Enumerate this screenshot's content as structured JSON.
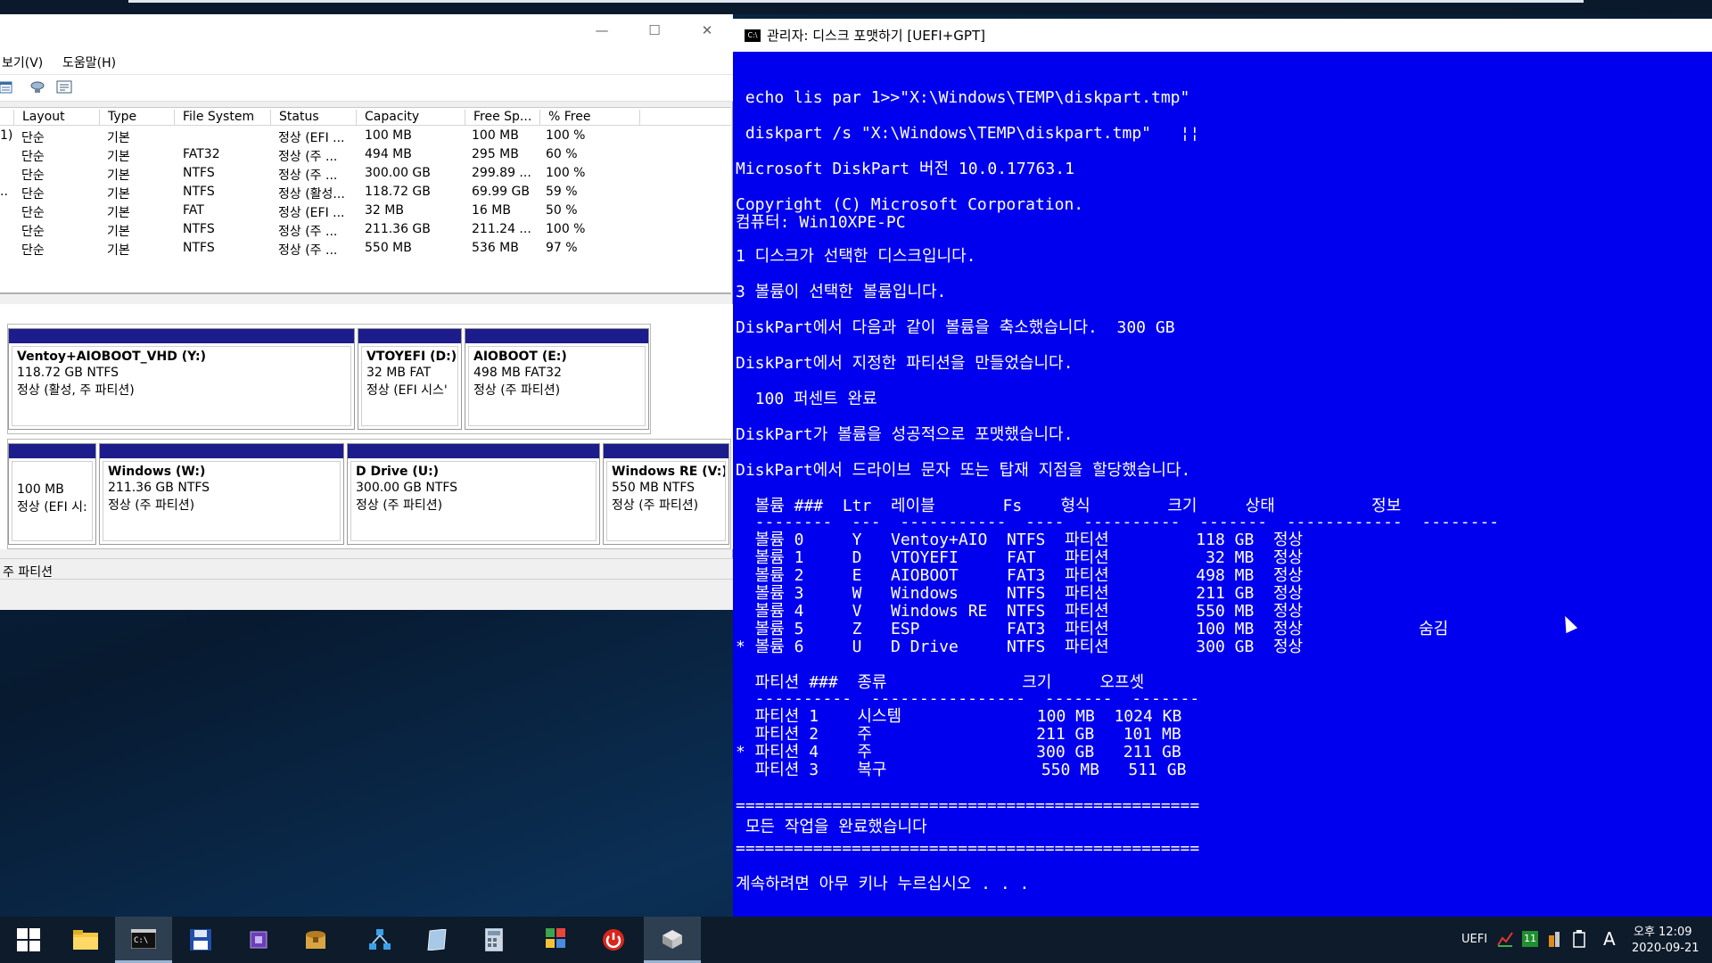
{
  "disk_management": {
    "menu": [
      "보기(V)",
      "도움말(H)"
    ],
    "columns": [
      "Layout",
      "Type",
      "File System",
      "Status",
      "Capacity",
      "Free Sp...",
      "% Free"
    ],
    "rows": [
      {
        "mark": "1)",
        "layout": "단순",
        "type": "기본",
        "fs": "",
        "status": "정상 (EFI ...",
        "capacity": "100 MB",
        "free": "100 MB",
        "pct": "100 %"
      },
      {
        "mark": "",
        "layout": "단순",
        "type": "기본",
        "fs": "FAT32",
        "status": "정상 (주 ...",
        "capacity": "494 MB",
        "free": "295 MB",
        "pct": "60 %"
      },
      {
        "mark": "",
        "layout": "단순",
        "type": "기본",
        "fs": "NTFS",
        "status": "정상 (주 ...",
        "capacity": "300.00 GB",
        "free": "299.89 ...",
        "pct": "100 %"
      },
      {
        "mark": "..",
        "layout": "단순",
        "type": "기본",
        "fs": "NTFS",
        "status": "정상 (활성...",
        "capacity": "118.72 GB",
        "free": "69.99 GB",
        "pct": "59 %"
      },
      {
        "mark": "",
        "layout": "단순",
        "type": "기본",
        "fs": "FAT",
        "status": "정상 (EFI ...",
        "capacity": "32 MB",
        "free": "16 MB",
        "pct": "50 %"
      },
      {
        "mark": "",
        "layout": "단순",
        "type": "기본",
        "fs": "NTFS",
        "status": "정상 (주 ...",
        "capacity": "211.36 GB",
        "free": "211.24 ...",
        "pct": "100 %"
      },
      {
        "mark": "",
        "layout": "단순",
        "type": "기본",
        "fs": "NTFS",
        "status": "정상 (주 ...",
        "capacity": "550 MB",
        "free": "536 MB",
        "pct": "97 %"
      }
    ],
    "disk1_parts": [
      {
        "name": "Ventoy+AIOBOOT_VHD  (Y:)",
        "size": "118.72 GB NTFS",
        "status": "정상 (활성, 주 파티션)"
      },
      {
        "name": "VTOYEFI  (D:)",
        "size": "32 MB FAT",
        "status": "정상 (EFI 시스'"
      },
      {
        "name": "AIOBOOT  (E:)",
        "size": "498 MB FAT32",
        "status": "정상 (주 파티션)"
      }
    ],
    "disk2_parts": [
      {
        "name": "",
        "size": "100 MB",
        "status": "정상 (EFI 시:"
      },
      {
        "name": "Windows  (W:)",
        "size": "211.36 GB NTFS",
        "status": "정상 (주 파티션)"
      },
      {
        "name": "D Drive  (U:)",
        "size": "300.00 GB NTFS",
        "status": "정상 (주 파티션)"
      },
      {
        "name": "Windows RE  (V:)",
        "size": "550 MB NTFS",
        "status": "정상 (주 파티션)"
      }
    ],
    "legend": "주 파티션"
  },
  "console": {
    "title": "관리자:  디스크 포맷하기 [UEFI+GPT]",
    "lines": [
      " echo lis par 1>>\"X:\\Windows\\TEMP\\diskpart.tmp\"",
      " diskpart /s \"X:\\Windows\\TEMP\\diskpart.tmp\"   ¦¦",
      "Microsoft DiskPart 버전 10.0.17763.1",
      "Copyright (C) Microsoft Corporation.",
      "컴퓨터: Win10XPE-PC",
      "1 디스크가 선택한 디스크입니다.",
      "3 볼륨이 선택한 볼륨입니다.",
      "DiskPart에서 다음과 같이 볼륨을 축소했습니다.  300 GB",
      "DiskPart에서 지정한 파티션을 만들었습니다.",
      "  100 퍼센트 완료",
      "DiskPart가 볼륨을 성공적으로 포맷했습니다.",
      "DiskPart에서 드라이브 문자 또는 탑재 지점을 할당했습니다.",
      "  볼륨 ###  Ltr  레이블       Fs    형식        크기     상태          정보",
      "  --------  ---  -----------  ----  ----------  -------  ------------  --------",
      "  볼륨 0     Y   Ventoy+AIO  NTFS  파티션         118 GB  정상",
      "  볼륨 1     D   VTOYEFI     FAT   파티션          32 MB  정상",
      "  볼륨 2     E   AIOBOOT     FAT3  파티션         498 MB  정상",
      "  볼륨 3     W   Windows     NTFS  파티션         211 GB  정상",
      "  볼륨 4     V   Windows RE  NTFS  파티션         550 MB  정상",
      "  볼륨 5     Z   ESP         FAT3  파티션         100 MB  정상            숨김",
      "* 볼륨 6     U   D Drive     NTFS  파티션         300 GB  정상",
      "  파티션 ###  종류              크기     오프셋",
      "  ----------  ----------------  -------  -------",
      "  파티션 1    시스템              100 MB  1024 KB",
      "  파티션 2    주                 211 GB   101 MB",
      "* 파티션 4    주                 300 GB   211 GB",
      "  파티션 3    복구                550 MB   511 GB",
      "================================================",
      " 모든 작업을 완료했습니다",
      "================================================",
      "계속하려면 아무 키나 누르십시오 . . ."
    ]
  },
  "taskbar": {
    "apps": [
      "start-icon",
      "file-explorer-icon",
      "console-icon",
      "floppy-disk-icon",
      "chip-icon",
      "archive-icon",
      "network-icon",
      "document-icon",
      "calculator-icon",
      "registry-icon",
      "power-icon",
      "package-icon"
    ],
    "tray_uefi": "UEFI",
    "tray_badge": "11",
    "tray_lang": "A",
    "time": "오후 12:09",
    "date": "2020-09-21"
  }
}
